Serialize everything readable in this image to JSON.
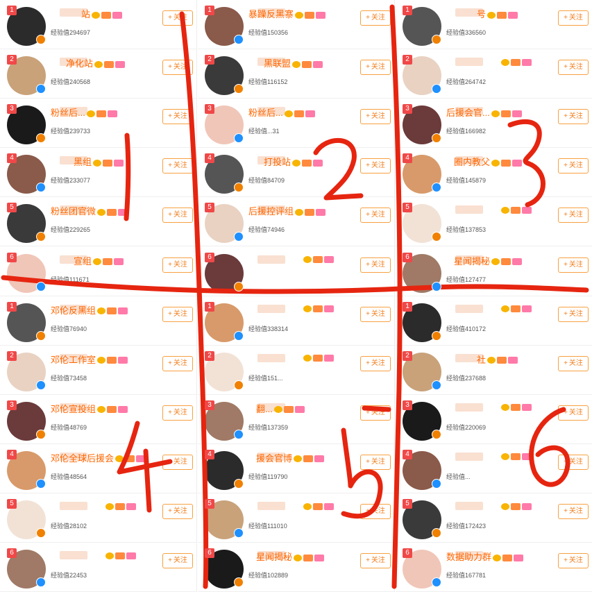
{
  "follow_label": "关注",
  "plus_glyph": "+",
  "colors": {
    "name": "#ff6600",
    "follow": "#f08020",
    "rank": "#f04848",
    "annotation": "#e62510"
  },
  "columns": [
    {
      "rows": [
        {
          "rank": "1",
          "name": "站",
          "exp": "经验值294697"
        },
        {
          "rank": "2",
          "name": "净化站",
          "exp": "经验值240568"
        },
        {
          "rank": "3",
          "name": "粉丝后...",
          "exp": "经验值239733"
        },
        {
          "rank": "4",
          "name": "黑组",
          "exp": "经验值233077"
        },
        {
          "rank": "5",
          "name": "粉丝团官微",
          "exp": "经验值229265"
        },
        {
          "rank": "6",
          "name": "宣组",
          "exp": "经验值111671"
        },
        {
          "rank": "1",
          "name": "邓伦反黑组",
          "exp": "经验值76940"
        },
        {
          "rank": "2",
          "name": "邓伦工作室",
          "exp": "经验值73458"
        },
        {
          "rank": "3",
          "name": "邓伦宣投组",
          "exp": "经验值48769"
        },
        {
          "rank": "4",
          "name": "邓伦全球后援会",
          "exp": "经验值48564"
        },
        {
          "rank": "5",
          "name": "",
          "exp": "经验值28102"
        },
        {
          "rank": "6",
          "name": "",
          "exp": "经验值22453"
        }
      ]
    },
    {
      "rows": [
        {
          "rank": "1",
          "name": "暴躁反黑寨",
          "exp": "经验值150356"
        },
        {
          "rank": "2",
          "name": "黑联盟",
          "exp": "经验值116152"
        },
        {
          "rank": "3",
          "name": "粉丝后...",
          "exp": "经验值...31"
        },
        {
          "rank": "4",
          "name": "打投站",
          "exp": "经验值84709"
        },
        {
          "rank": "5",
          "name": "后援控评组",
          "exp": "经验值74946"
        },
        {
          "rank": "6",
          "name": "",
          "exp": ""
        },
        {
          "rank": "1",
          "name": "",
          "exp": "经验值338314"
        },
        {
          "rank": "2",
          "name": "",
          "exp": "经验值151..."
        },
        {
          "rank": "3",
          "name": "翻...",
          "exp": "经验值137359"
        },
        {
          "rank": "4",
          "name": "援会官博",
          "exp": "经验值119790"
        },
        {
          "rank": "5",
          "name": "",
          "exp": "经验值111010"
        },
        {
          "rank": "6",
          "name": "星闻揭秘",
          "exp": "经验值102889"
        }
      ]
    },
    {
      "rows": [
        {
          "rank": "1",
          "name": "号",
          "exp": "经验值336560"
        },
        {
          "rank": "2",
          "name": "",
          "exp": "经验值264742"
        },
        {
          "rank": "3",
          "name": "后援会官...",
          "exp": "经验值166982"
        },
        {
          "rank": "4",
          "name": "圈内教父",
          "exp": "经验值145879"
        },
        {
          "rank": "5",
          "name": "",
          "exp": "经验值137853"
        },
        {
          "rank": "6",
          "name": "星闻揭秘",
          "exp": "经验值127477"
        },
        {
          "rank": "1",
          "name": "",
          "exp": "经验值410172"
        },
        {
          "rank": "2",
          "name": "社",
          "exp": "经验值237688"
        },
        {
          "rank": "3",
          "name": "",
          "exp": "经验值220069"
        },
        {
          "rank": "4",
          "name": "",
          "exp": "经验值..."
        },
        {
          "rank": "5",
          "name": "",
          "exp": "经验值172423"
        },
        {
          "rank": "6",
          "name": "数据助力群",
          "exp": "经验值167781"
        }
      ]
    }
  ],
  "annotations": [
    "1",
    "2",
    "3",
    "4",
    "5",
    "6"
  ]
}
